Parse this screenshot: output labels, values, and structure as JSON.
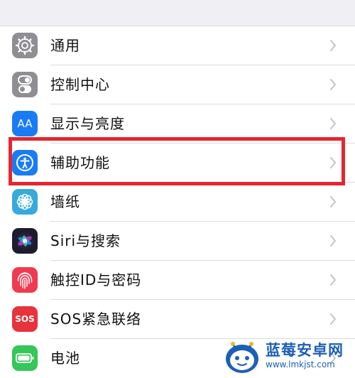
{
  "settings_list": {
    "items": [
      {
        "label": "通用",
        "icon": "gear-icon",
        "icon_color": "#8e8e93"
      },
      {
        "label": "控制中心",
        "icon": "toggles-icon",
        "icon_color": "#8e8e93"
      },
      {
        "label": "显示与亮度",
        "icon": "text-size-icon",
        "icon_color": "#1a7cf5"
      },
      {
        "label": "辅助功能",
        "icon": "accessibility-icon",
        "icon_color": "#1a7cf5"
      },
      {
        "label": "墙纸",
        "icon": "wallpaper-flower-icon",
        "icon_color": "#36aadc"
      },
      {
        "label": "Siri与搜索",
        "icon": "siri-icon",
        "icon_color": "#1c1c2e"
      },
      {
        "label": "触控ID与密码",
        "icon": "fingerprint-icon",
        "icon_color": "#f03a50"
      },
      {
        "label": "SOS紧急联络",
        "icon": "sos-icon",
        "icon_color": "#e8323c"
      },
      {
        "label": "电池",
        "icon": "battery-icon",
        "icon_color": "#34c759"
      }
    ],
    "icon_texts": {
      "aa": "AA",
      "sos": "SOS"
    }
  },
  "highlight": {
    "target": "辅助功能",
    "color": "#e3262f"
  },
  "watermark": {
    "title": "蓝莓安卓网",
    "url": "www.lmkjst.com"
  }
}
